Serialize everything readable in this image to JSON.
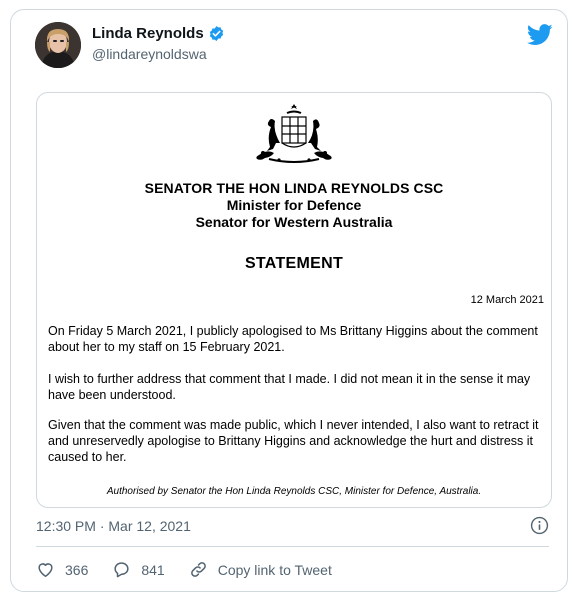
{
  "tweet": {
    "author": {
      "display_name": "Linda Reynolds",
      "handle": "@lindareynoldswa",
      "verified": true
    },
    "statement": {
      "heading_line1": "SENATOR THE HON LINDA REYNOLDS CSC",
      "heading_line2": "Minister for Defence",
      "heading_line3": "Senator for Western Australia",
      "title": "STATEMENT",
      "date": "12 March 2021",
      "paragraphs": [
        "On Friday 5 March 2021, I publicly apologised to Ms Brittany Higgins about the comment about her to my staff on 15 February 2021.",
        "I wish to further address that comment that I made. I did not mean it in the sense it may have been understood.",
        "Given that the comment was made public, which I never intended, I also want to retract it and unreservedly apologise to Brittany Higgins and acknowledge the hurt and distress it caused to her."
      ],
      "authorised": "Authorised by Senator the Hon Linda Reynolds CSC, Minister for Defence, Australia."
    },
    "timestamp": "12:30 PM · Mar 12, 2021",
    "actions": {
      "likes": "366",
      "replies": "841",
      "copy_link": "Copy link to Tweet"
    },
    "colors": {
      "twitter_blue": "#1d9bf0",
      "secondary_text": "#536471",
      "border": "#cfd9de"
    },
    "icons": [
      "verified-badge-icon",
      "twitter-bird-icon",
      "australian-coat-of-arms",
      "info-icon",
      "heart-icon",
      "reply-icon",
      "link-icon"
    ]
  }
}
